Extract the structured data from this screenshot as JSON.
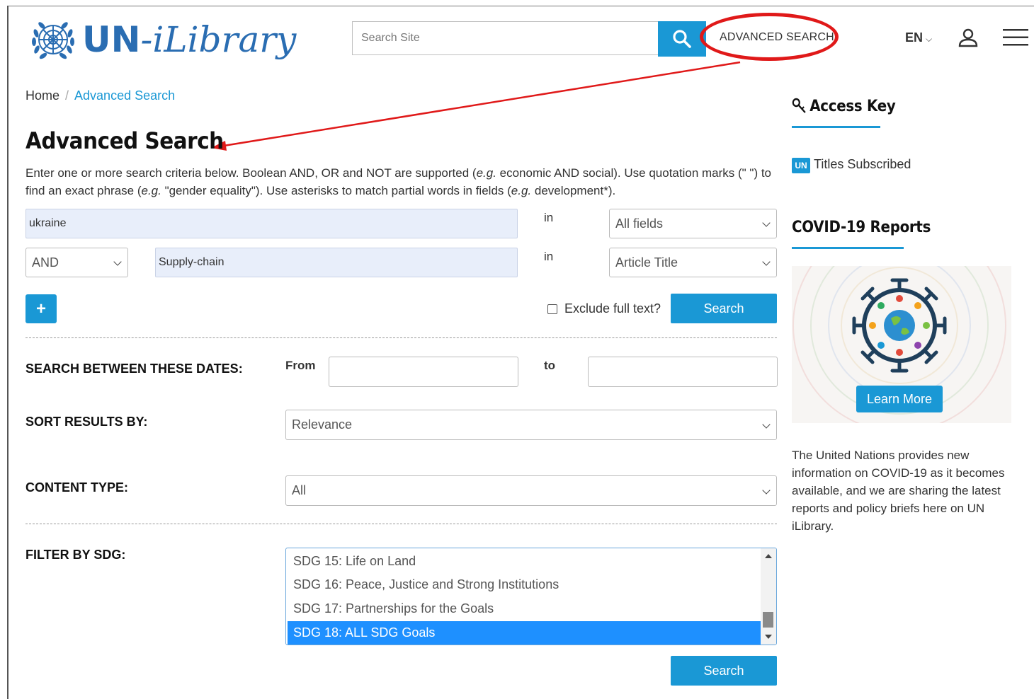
{
  "header": {
    "logo_un": "UN",
    "logo_dash": "-",
    "logo_library": "iLibrary",
    "search_placeholder": "Search Site",
    "advanced_search_link": "ADVANCED SEARCH",
    "language": "EN"
  },
  "breadcrumb": {
    "home": "Home",
    "separator": "/",
    "current": "Advanced Search"
  },
  "page": {
    "title": "Advanced Search",
    "intro_parts": [
      "Enter one or more search criteria below. Boolean AND, OR and NOT are supported (",
      "e.g.",
      " economic AND social). Use quotation marks (\" \") to find an exact phrase (",
      "e.g.",
      " \"gender equality\"). Use asterisks to match partial words in fields (",
      "e.g.",
      " development*)."
    ]
  },
  "criteria": {
    "row1": {
      "value": "ukraine",
      "in_label": "in",
      "field": "All fields"
    },
    "row2": {
      "operator": "AND",
      "value": "Supply-chain",
      "in_label": "in",
      "field": "Article Title"
    },
    "add_button": "+",
    "exclude_full_text_label": "Exclude full text?",
    "exclude_full_text_checked": false,
    "search_button": "Search"
  },
  "dates": {
    "label": "SEARCH BETWEEN THESE DATES:",
    "from_label": "From",
    "to_label": "to",
    "from_value": "",
    "to_value": ""
  },
  "sort": {
    "label": "SORT RESULTS BY:",
    "value": "Relevance"
  },
  "content_type": {
    "label": "CONTENT TYPE:",
    "value": "All"
  },
  "sdg": {
    "label": "FILTER BY SDG:",
    "options": [
      "SDG 15: Life on Land",
      "SDG 16: Peace, Justice and Strong Institutions",
      "SDG 17: Partnerships for the Goals",
      "SDG 18: ALL SDG Goals"
    ],
    "selected": "SDG 18: ALL SDG Goals"
  },
  "bottom_search_button": "Search",
  "sidebar": {
    "access_key_title": "Access Key",
    "un_badge": "UN",
    "titles_subscribed": "Titles Subscribed",
    "covid_title": "COVID-19 Reports",
    "learn_more": "Learn More",
    "covid_text": "The United Nations provides new information on COVID-19 as it becomes available, and we are sharing the latest reports and policy briefs here on UN iLibrary."
  },
  "colors": {
    "accent": "#1a98d5",
    "logo": "#2a6db2",
    "annotation": "#e01919",
    "selected_option": "#1e90ff"
  },
  "icons": [
    "un-emblem-icon",
    "search-icon",
    "chevron-down-icon",
    "user-icon",
    "hamburger-menu-icon",
    "key-icon",
    "covid-virus-globe-icon"
  ]
}
